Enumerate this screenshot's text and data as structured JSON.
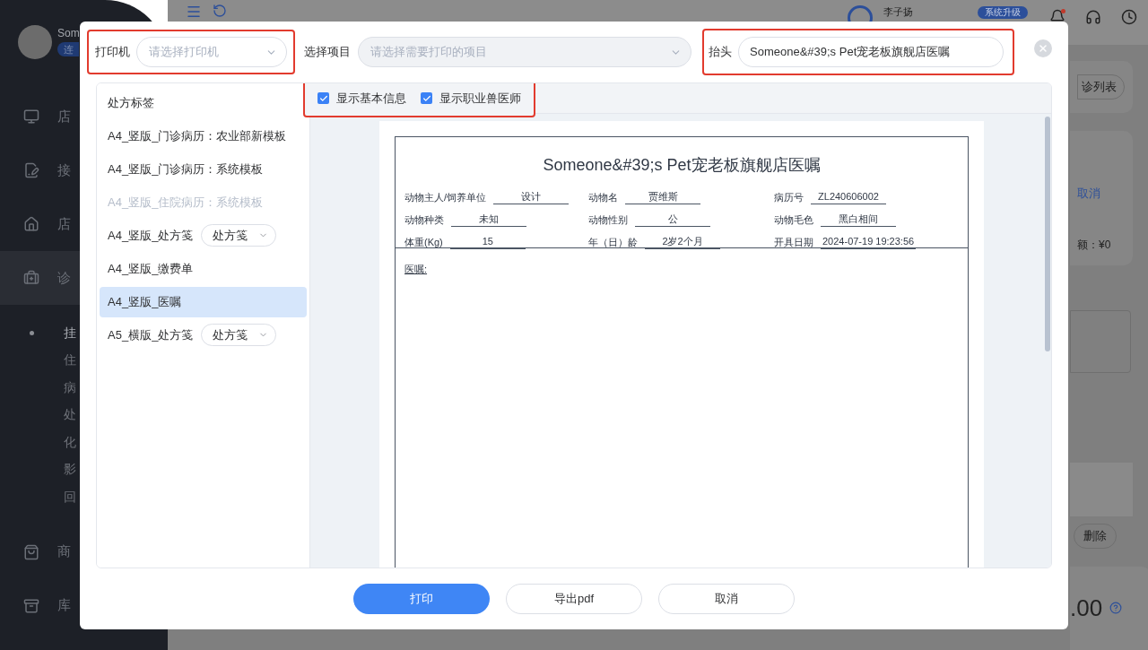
{
  "background": {
    "sidebar": {
      "user_name": "Som",
      "badge": "连",
      "nav": [
        {
          "label": "店",
          "selected": false
        },
        {
          "label": "接",
          "selected": false
        },
        {
          "label": "店",
          "selected": false
        },
        {
          "label": "诊",
          "selected": true
        }
      ],
      "sub_items": [
        {
          "label": "挂",
          "selected": true
        },
        {
          "label": "住",
          "selected": false
        },
        {
          "label": "病",
          "selected": false
        },
        {
          "label": "处",
          "selected": false
        },
        {
          "label": "化",
          "selected": false
        },
        {
          "label": "影",
          "selected": false
        },
        {
          "label": "回",
          "selected": false
        }
      ],
      "nav_bottom": [
        {
          "label": "商",
          "selected": false
        },
        {
          "label": "库",
          "selected": false
        }
      ]
    },
    "header": {
      "user": "李子扬",
      "upgrade": "系统升级",
      "notification_dot": true
    },
    "content": {
      "list_button": "诊列表",
      "cancel_link": "取消",
      "amount": "额：¥0",
      "delete_button": "删除",
      "total": ".00"
    }
  },
  "dialog": {
    "printer": {
      "label": "打印机",
      "placeholder": "请选择打印机"
    },
    "project": {
      "label": "选择项目",
      "placeholder": "请选择需要打印的项目",
      "disabled": true
    },
    "header_field": {
      "label": "抬头",
      "value": "Someone&#39;s Pet宠老板旗舰店医嘱"
    },
    "templates": [
      {
        "label": "处方标签",
        "disabled": false,
        "selected": false
      },
      {
        "label": "A4_竖版_门诊病历：农业部新模板",
        "disabled": false,
        "selected": false
      },
      {
        "label": "A4_竖版_门诊病历：系统模板",
        "disabled": false,
        "selected": false
      },
      {
        "label": "A4_竖版_住院病历：系统模板",
        "disabled": true,
        "selected": false
      },
      {
        "label": "A4_竖版_处方笺",
        "disabled": false,
        "selected": false,
        "dropdown": "处方笺"
      },
      {
        "label": "A4_竖版_缴费单",
        "disabled": false,
        "selected": false
      },
      {
        "label": "A4_竖版_医嘱",
        "disabled": false,
        "selected": true
      },
      {
        "label": "A5_横版_处方笺",
        "disabled": false,
        "selected": false,
        "dropdown": "处方笺"
      }
    ],
    "options": [
      {
        "label": "显示基本信息",
        "checked": true
      },
      {
        "label": "显示职业兽医师",
        "checked": true
      }
    ],
    "document": {
      "title": "Someone&#39;s Pet宠老板旗舰店医嘱",
      "fields": [
        {
          "label": "动物主人/饲养单位",
          "value": "设计"
        },
        {
          "label": "动物名",
          "value": "贾维斯"
        },
        {
          "label": "病历号",
          "value": "ZL240606002"
        },
        {
          "label": "动物种类",
          "value": "未知"
        },
        {
          "label": "动物性别",
          "value": "公"
        },
        {
          "label": "动物毛色",
          "value": "黑白相间"
        },
        {
          "label": "体重(Kg)",
          "value": "15"
        },
        {
          "label": "年（日）龄",
          "value": "2岁2个月"
        },
        {
          "label": "开具日期",
          "value": "2024-07-19 19:23:56"
        }
      ],
      "advice_label": "医嘱:"
    },
    "buttons": [
      {
        "label": "打印",
        "kind": "primary"
      },
      {
        "label": "导出pdf",
        "kind": "default"
      },
      {
        "label": "取消",
        "kind": "default"
      }
    ]
  }
}
